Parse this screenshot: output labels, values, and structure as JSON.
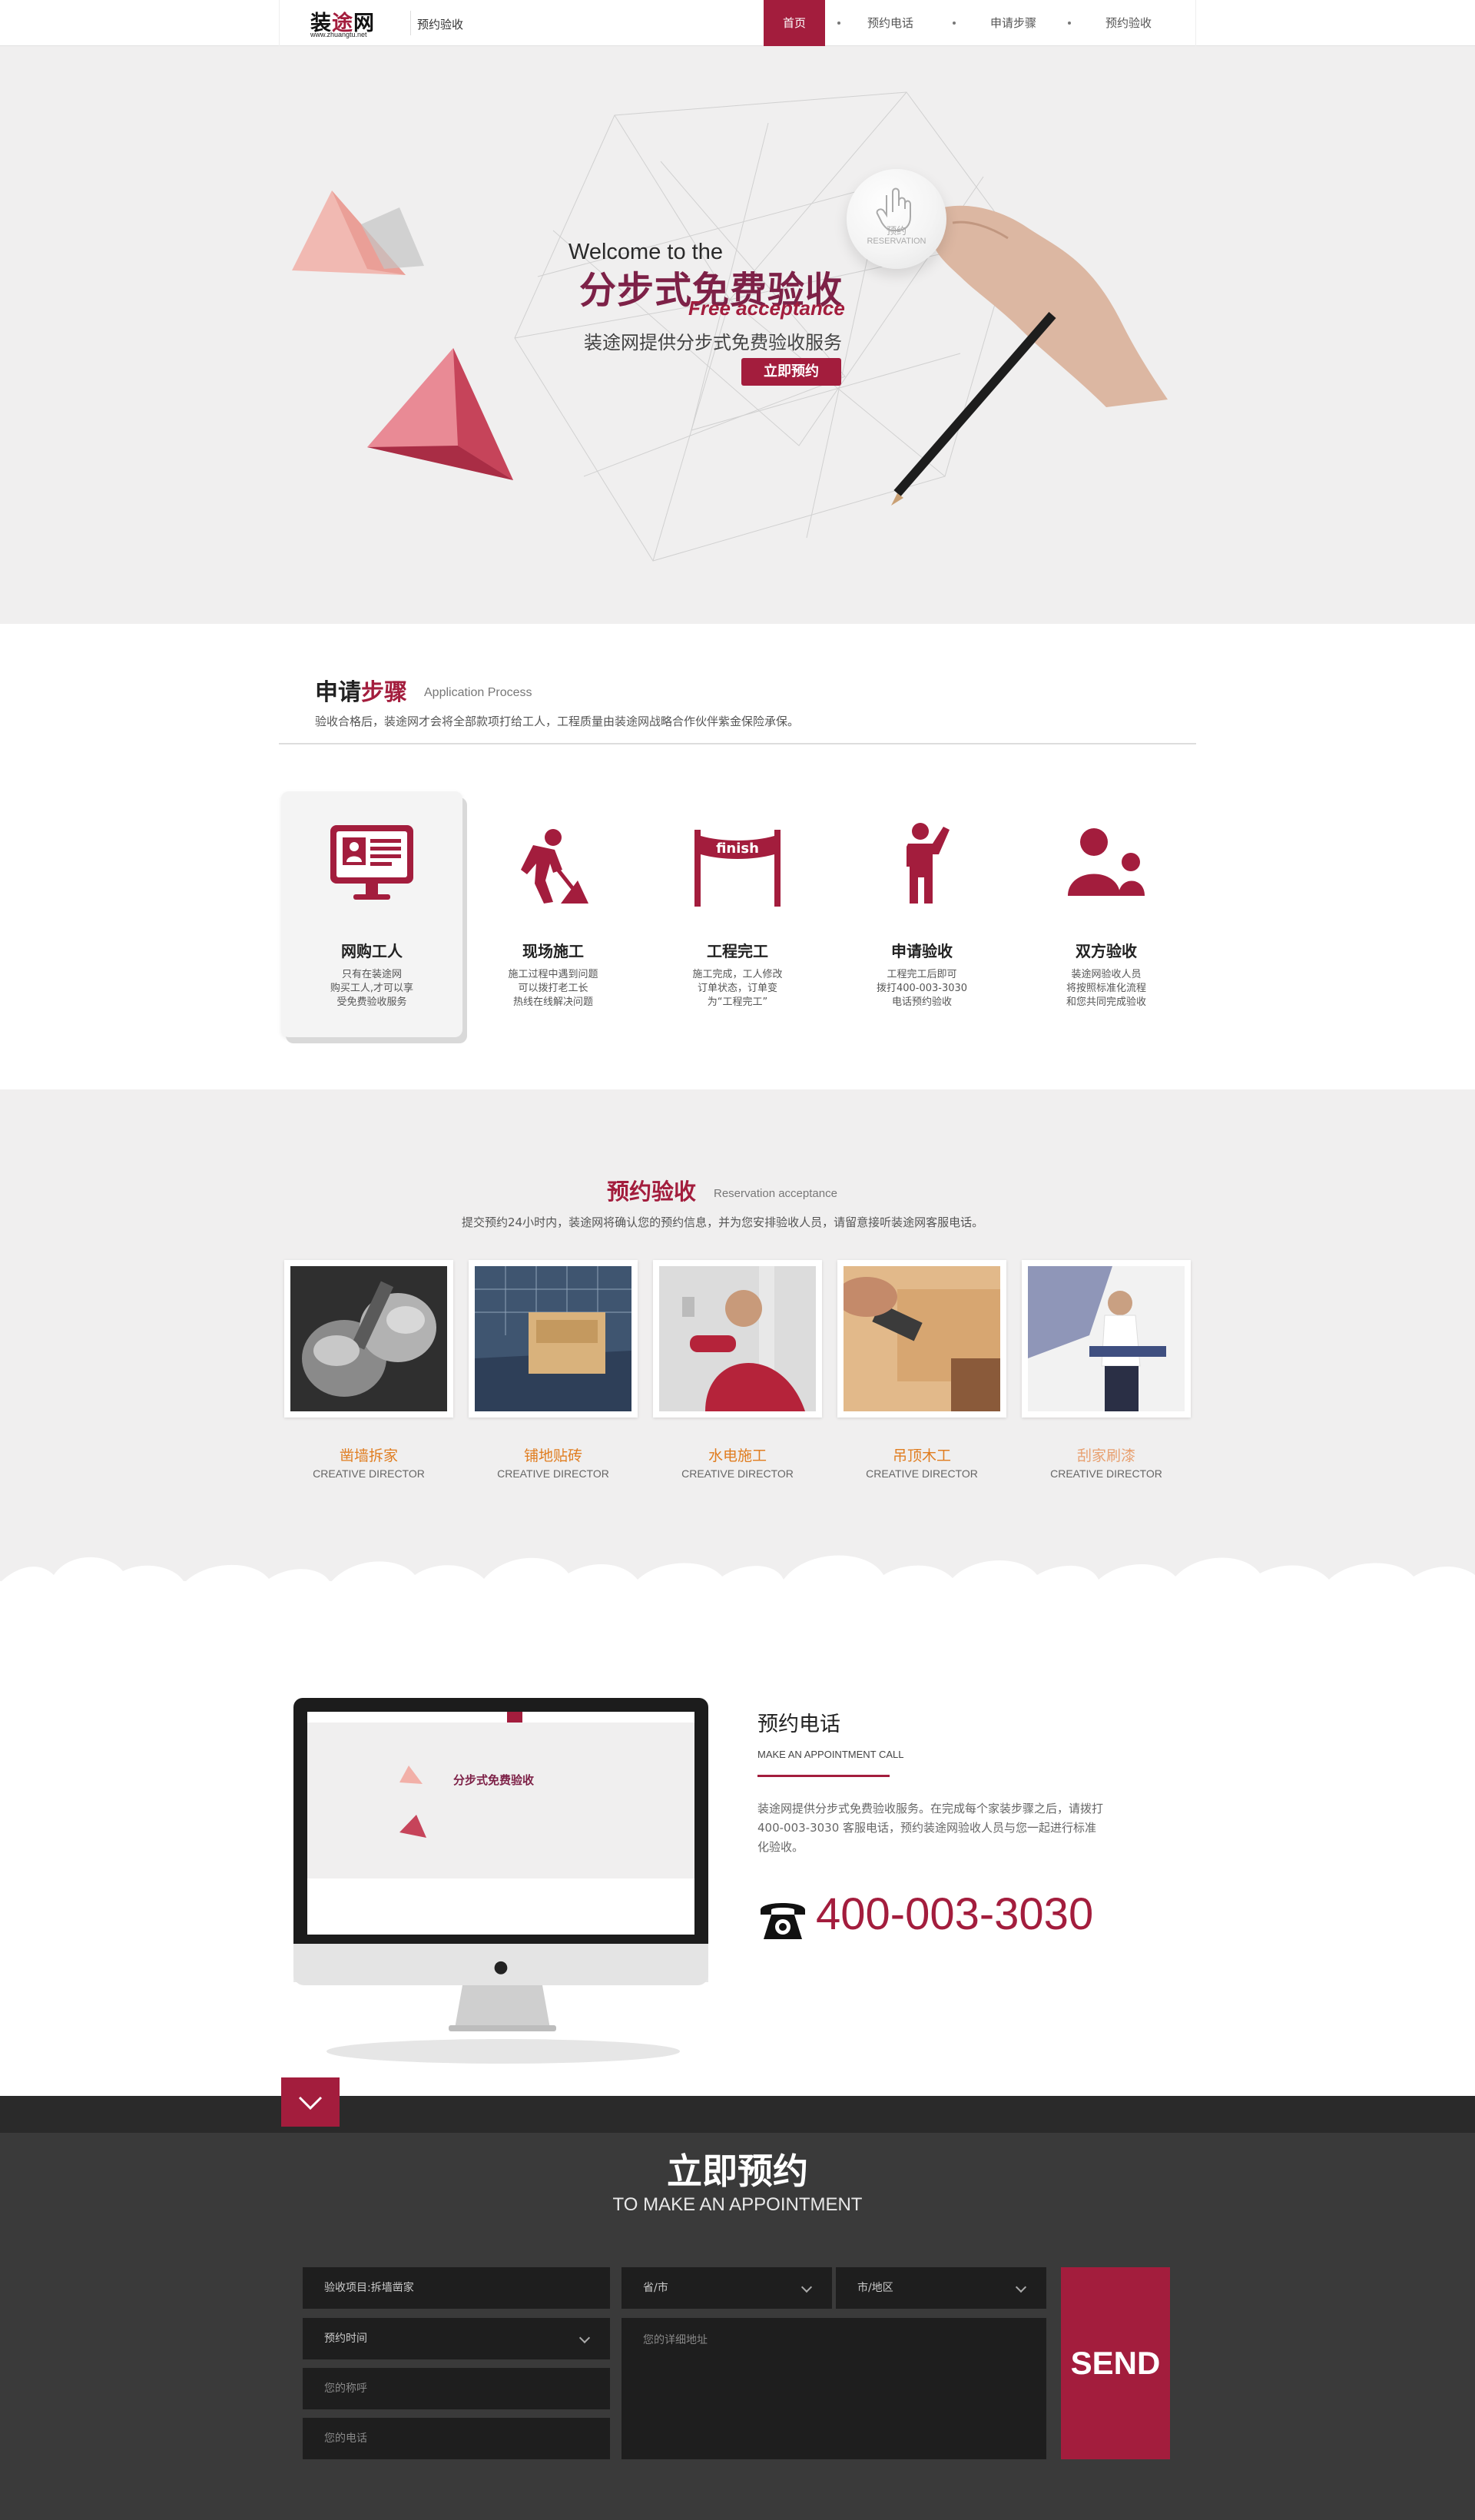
{
  "nav": {
    "logo_text_a": "装",
    "logo_text_b": "途",
    "logo_text_c": "网",
    "logo_sub": "www.zhuangtu.net",
    "page_name": "预约验收",
    "items": [
      {
        "label": "首页"
      },
      {
        "label": "预约电话"
      },
      {
        "label": "申请步骤"
      },
      {
        "label": "预约验收"
      }
    ]
  },
  "hero": {
    "line1": "Welcome to the",
    "line2": "分步式免费验收",
    "line3": "Free acceptance",
    "subtitle": "装途网提供分步式免费验收服务",
    "button": "立即预约",
    "bubble_label": "预约",
    "bubble_en": "RESERVATION"
  },
  "process": {
    "title_a": "申请",
    "title_b": "步骤",
    "title_en": "Application Process",
    "desc": "验收合格后，装途网才会将全部款项打给工人，工程质量由装途网战略合作伙伴紫金保险承保。",
    "steps": [
      {
        "title": "网购工人",
        "text": "只有在装途网\n购买工人,才可以享\n受免费验收服务",
        "icon": "monitor-profile-icon"
      },
      {
        "title": "现场施工",
        "text": "施工过程中遇到问题\n可以拨打老工长\n热线在线解决问题",
        "icon": "worker-shovel-icon"
      },
      {
        "title": "工程完工",
        "text": "施工完成，工人修改\n订单状态，订单变\n为“工程完工”",
        "icon": "finish-line-icon"
      },
      {
        "title": "申请验收",
        "text": "工程完工后即可\n拨打400-003-3030\n电话预约验收",
        "icon": "person-hand-raised-icon"
      },
      {
        "title": "双方验收",
        "text": "装途网验收人员\n将按照标准化流程\n和您共同完成验收",
        "icon": "two-people-icon"
      }
    ]
  },
  "reservation": {
    "title": "预约验收",
    "title_en": "Reservation acceptance",
    "desc": "提交预约24小时内，装途网将确认您的预约信息，并为您安排验收人员，请留意接听装途网客服电话。",
    "items": [
      {
        "label": "凿墙拆家",
        "sub": "CREATIVE DIRECTOR"
      },
      {
        "label": "铺地贴砖",
        "sub": "CREATIVE DIRECTOR"
      },
      {
        "label": "水电施工",
        "sub": "CREATIVE DIRECTOR"
      },
      {
        "label": "吊顶木工",
        "sub": "CREATIVE DIRECTOR"
      },
      {
        "label": "刮家刷漆",
        "sub": "CREATIVE DIRECTOR"
      }
    ]
  },
  "phone": {
    "title": "预约电话",
    "title_en": "MAKE AN APPOINTMENT CALL",
    "desc": "装途网提供分步式免费验收服务。在完成每个家装步骤之后，请拨打 400-003-3030 客服电话，预约装途网验收人员与您一起进行标准化验收。",
    "number": "400-003-3030"
  },
  "form": {
    "title": "立即预约",
    "title_en": "TO MAKE AN APPOINTMENT",
    "project_value": "验收项目:拆墙凿家",
    "time_value": "预约时间",
    "name_placeholder": "您的称呼",
    "phone_placeholder": "您的电话",
    "province_value": "省/市",
    "city_value": "市/地区",
    "address_placeholder": "您的详细地址",
    "send": "SEND"
  },
  "colors": {
    "brand": "#a31d3d",
    "accent_orange": "#e07d20",
    "dark_bg": "#3a3a3a"
  }
}
